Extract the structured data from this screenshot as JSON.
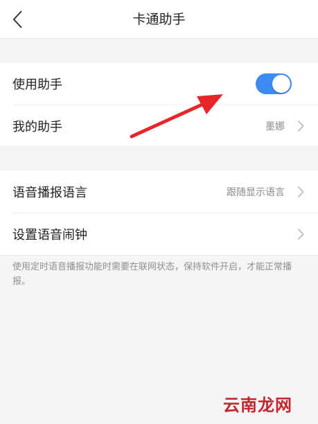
{
  "header": {
    "title": "卡通助手",
    "back_icon": "back-chevron-icon"
  },
  "settings_group_1": {
    "rows": [
      {
        "label": "使用助手",
        "toggle_on": true
      },
      {
        "label": "我的助手",
        "value": "墨娜"
      }
    ]
  },
  "settings_group_2": {
    "rows": [
      {
        "label": "语音播报语言",
        "value": "跟随显示语言"
      },
      {
        "label": "设置语音闹钟"
      }
    ]
  },
  "note": "使用定时语音播报功能时需要在联网状态，保持软件开启，才能正常播报。",
  "watermark": "云南龙网",
  "colors": {
    "accent": "#3d8bf2",
    "annotation_arrow": "#e8262a",
    "watermark": "#c1272d"
  }
}
